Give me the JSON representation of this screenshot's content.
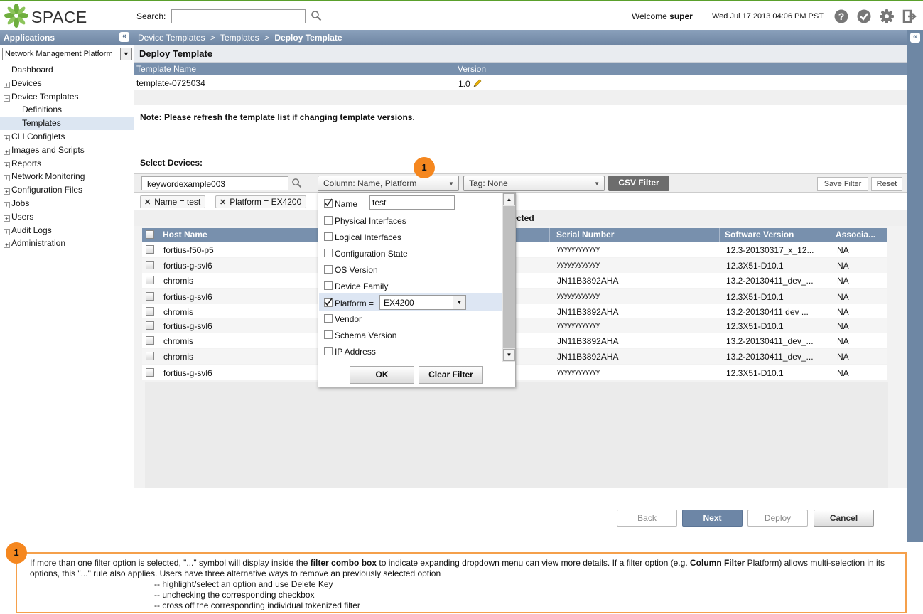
{
  "header": {
    "brand": "SPACE",
    "search_label": "Search:",
    "search_value": "",
    "welcome_prefix": "Welcome",
    "username": "super",
    "datetime": "Wed Jul 17 2013 04:06 PM PST"
  },
  "left": {
    "title": "Applications",
    "collapse": "«",
    "app_select": "Network Management Platform",
    "nav": [
      {
        "label": "Dashboard",
        "type": "leaf"
      },
      {
        "label": "Devices",
        "type": "plus"
      },
      {
        "label": "Device Templates",
        "type": "minus"
      },
      {
        "label": "Definitions",
        "type": "child"
      },
      {
        "label": "Templates",
        "type": "child",
        "selected": true
      },
      {
        "label": "CLI Configlets",
        "type": "plus"
      },
      {
        "label": "Images and Scripts",
        "type": "plus"
      },
      {
        "label": "Reports",
        "type": "plus"
      },
      {
        "label": "Network Monitoring",
        "type": "plus"
      },
      {
        "label": "Configuration Files",
        "type": "plus"
      },
      {
        "label": "Jobs",
        "type": "plus"
      },
      {
        "label": "Users",
        "type": "plus"
      },
      {
        "label": "Audit Logs",
        "type": "plus"
      },
      {
        "label": "Administration",
        "type": "plus"
      }
    ]
  },
  "breadcrumb": {
    "items": [
      "Device Templates",
      "Templates"
    ],
    "separator": ">",
    "current": "Deploy Template",
    "right_collapse": "«"
  },
  "page": {
    "title": "Deploy Template",
    "template_cols": [
      "Template Name",
      "Version"
    ],
    "template_row": {
      "name": "template-0725034",
      "version": "1.0"
    },
    "note": "Note: Please refresh the template list if changing template versions.",
    "select_devices": "Select Devices:"
  },
  "filter": {
    "keyword": "keywordexample003",
    "column_combo": "Column: Name, Platform",
    "tag_combo": "Tag: None",
    "csv_button": "CSV Filter",
    "save_filter": "Save Filter",
    "reset": "Reset",
    "tokens": [
      "Name = test",
      "Platform = EX4200"
    ],
    "selected_text": "lected"
  },
  "grid": {
    "columns": [
      "Host Name",
      "Serial Number",
      "Software Version",
      "Associa..."
    ],
    "rows": [
      {
        "host": "fortius-f50-p5",
        "serial": "yyyyyyyyyyyy",
        "version": "12.3-20130317_x_12...",
        "assoc": "NA"
      },
      {
        "host": "fortius-g-svl6",
        "serial": "yyyyyyyyyyyy",
        "version": "12.3X51-D10.1",
        "assoc": "NA"
      },
      {
        "host": "chromis",
        "serial": "JN11B3892AHA",
        "version": "13.2-20130411_dev_...",
        "assoc": "NA"
      },
      {
        "host": "fortius-g-svl6",
        "serial": "yyyyyyyyyyyy",
        "version": "12.3X51-D10.1",
        "assoc": "NA"
      },
      {
        "host": "chromis",
        "serial": "JN11B3892AHA",
        "version": "13.2-20130411  dev  ...",
        "assoc": "NA"
      },
      {
        "host": "fortius-g-svl6",
        "serial": "yyyyyyyyyyyy",
        "version": "12.3X51-D10.1",
        "assoc": "NA"
      },
      {
        "host": "chromis",
        "serial": "JN11B3892AHA",
        "version": "13.2-20130411_dev_...",
        "assoc": "NA"
      },
      {
        "host": "chromis",
        "serial": "JN11B3892AHA",
        "version": "13.2-20130411_dev_...",
        "assoc": "NA"
      },
      {
        "host": "fortius-g-svl6",
        "serial": "yyyyyyyyyyyy",
        "version": "12.3X51-D10.1",
        "assoc": "NA"
      }
    ]
  },
  "dropdown": {
    "items": [
      {
        "label": "Name =",
        "checked": true
      },
      {
        "label": "Physical Interfaces",
        "checked": false
      },
      {
        "label": "Logical Interfaces",
        "checked": false
      },
      {
        "label": "Configuration State",
        "checked": false
      },
      {
        "label": "OS Version",
        "checked": false
      },
      {
        "label": "Device Family",
        "checked": false
      },
      {
        "label": "Platform =",
        "checked": true
      },
      {
        "label": "Vendor",
        "checked": false
      },
      {
        "label": "Schema Version",
        "checked": false
      },
      {
        "label": "IP Address",
        "checked": false
      }
    ],
    "name_value": "test",
    "platform_value": "EX4200",
    "ok": "OK",
    "clear": "Clear Filter"
  },
  "wizard": {
    "back": "Back",
    "next": "Next",
    "deploy": "Deploy",
    "cancel": "Cancel"
  },
  "callout": {
    "number": "1",
    "line1_a": "If more than one filter option is selected, \"...\" symbol will display inside the ",
    "line1_b": "filter combo box",
    "line1_c": " to indicate expanding dropdown menu can view more details. If a filter option (e.g. ",
    "line1_d": "Column Filter",
    "line1_e": " Platform) allows multi-selection in its options, this \"...\" rule also applies. Users have three alternative ways to remove an previously selected option",
    "opt1": "-- highlight/select an option and use Delete Key",
    "opt2": "-- unchecking the corresponding checkbox",
    "opt3": "-- cross off the corresponding individual tokenized filter"
  },
  "colors": {
    "header_blue": "#7890ad",
    "accent_orange": "#f5871f",
    "brand_green": "#5aa02c"
  }
}
